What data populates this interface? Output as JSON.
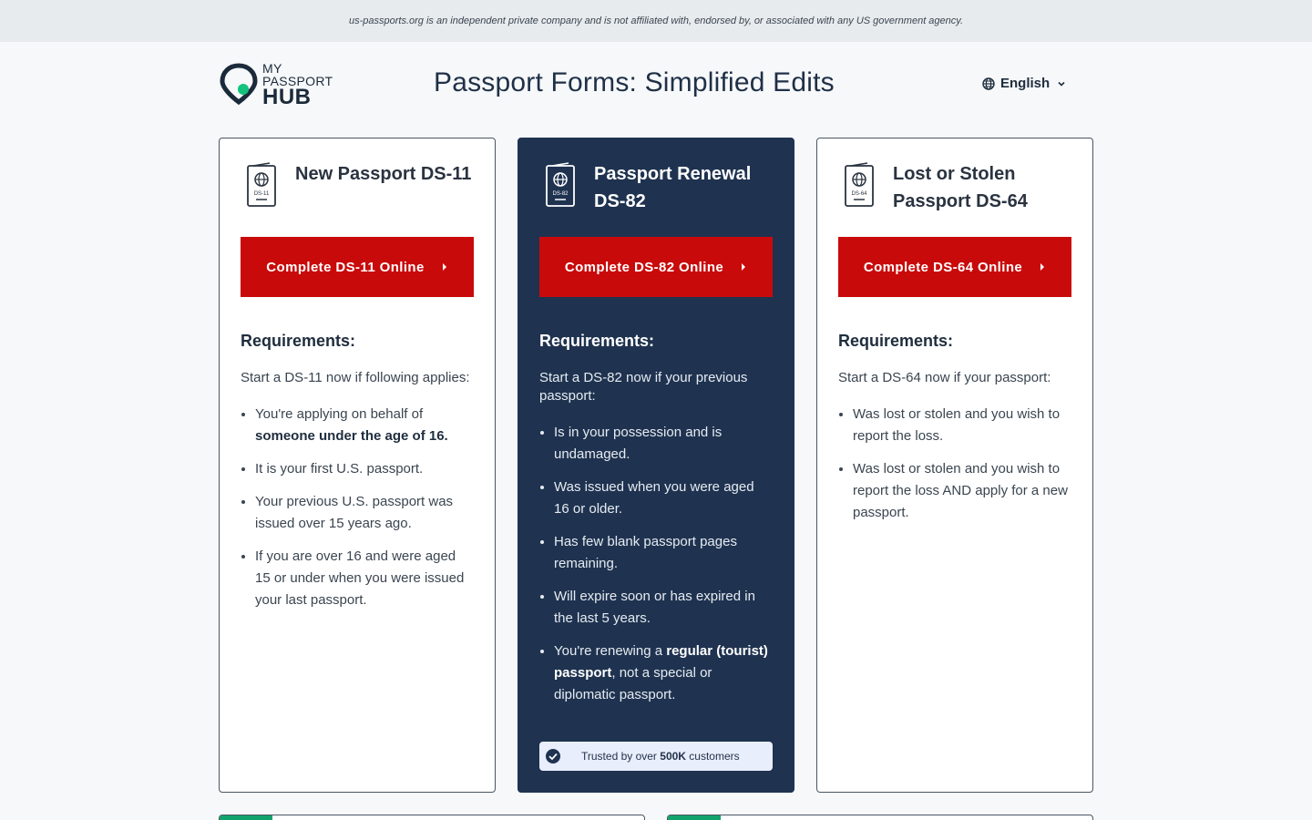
{
  "disclaimer": "us-passports.org is an independent private company and is not affiliated with, endorsed by, or associated with any US government agency.",
  "logo": {
    "line1": "MY",
    "line2": "PASSPORT",
    "line3": "HUB",
    "icon": "location-pin-icon"
  },
  "page_title": "Passport Forms: Simplified Edits",
  "language": {
    "label": "English",
    "icon": "globe-icon",
    "chevron": "chevron-down-icon"
  },
  "cards": [
    {
      "icon_label": "DS-11",
      "title": "New Passport DS-11",
      "cta": "Complete DS-11 Online",
      "req_title": "Requirements:",
      "intro": "Start a DS-11 now if following applies:",
      "items": [
        {
          "pre": "You're applying on behalf of ",
          "bold": "someone under the age of 16.",
          "post": ""
        },
        {
          "pre": "It is your first U.S. passport.",
          "bold": "",
          "post": ""
        },
        {
          "pre": "Your previous U.S. passport was issued over 15 years ago.",
          "bold": "",
          "post": ""
        },
        {
          "pre": "If you are over 16 and were aged 15 or under when you were issued your last passport.",
          "bold": "",
          "post": ""
        }
      ]
    },
    {
      "icon_label": "DS-82",
      "title": "Passport Renewal DS-82",
      "cta": "Complete DS-82 Online",
      "req_title": "Requirements:",
      "intro": "Start a DS-82 now if your previous passport:",
      "items": [
        {
          "pre": "Is in your possession and is undamaged.",
          "bold": "",
          "post": ""
        },
        {
          "pre": "Was issued when you were aged 16 or older.",
          "bold": "",
          "post": ""
        },
        {
          "pre": "Has few blank passport pages remaining.",
          "bold": "",
          "post": ""
        },
        {
          "pre": "Will expire soon or has expired in the last 5 years.",
          "bold": "",
          "post": ""
        },
        {
          "pre": "You're renewing a ",
          "bold": "regular (tourist) passport",
          "post": ", not a special or diplomatic passport."
        }
      ],
      "trust": {
        "pre": "Trusted by over ",
        "bold": "500K",
        "post": " customers",
        "icon": "check-badge-icon"
      }
    },
    {
      "icon_label": "DS-64",
      "title": "Lost or Stolen Passport DS-64",
      "cta": "Complete DS-64 Online",
      "req_title": "Requirements:",
      "intro": "Start a DS-64 now if your passport:",
      "items": [
        {
          "pre": "Was lost or stolen and you wish to report the loss.",
          "bold": "",
          "post": ""
        },
        {
          "pre": "Was lost or stolen and you wish to report the loss AND apply for a new passport.",
          "bold": "",
          "post": ""
        }
      ]
    }
  ],
  "colors": {
    "cta": "#c90a0a",
    "dark_card": "#1f3350",
    "accent": "#12a36c"
  }
}
